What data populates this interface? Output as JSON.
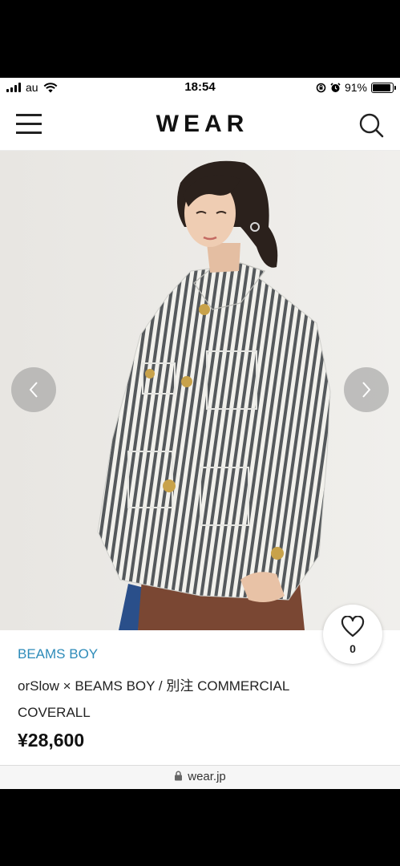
{
  "status_bar": {
    "carrier": "au",
    "time": "18:54",
    "battery_percent": "91%",
    "battery_level": 0.91,
    "icons": [
      "signal-icon",
      "wifi-icon",
      "rotation-lock-icon",
      "alarm-icon",
      "battery-icon"
    ]
  },
  "header": {
    "logo": "WEAR",
    "icons": [
      "hamburger-menu-icon",
      "search-icon"
    ]
  },
  "hero": {
    "image": "model-wearing-striped-coverall-jacket",
    "carousel_icons": [
      "chevron-left-icon",
      "chevron-right-icon"
    ]
  },
  "product": {
    "brand": "BEAMS BOY",
    "title": "orSlow × BEAMS BOY / 別注 COMMERCIAL COVERALL",
    "price": "¥28,600",
    "like_count": "0",
    "like_icon": "heart-outline-icon"
  },
  "browser": {
    "url": "wear.jp",
    "icon": "lock-icon"
  },
  "colors": {
    "brand_link": "#2d8bb9",
    "background": "#ffffff",
    "hero_background": "#eceae6"
  }
}
